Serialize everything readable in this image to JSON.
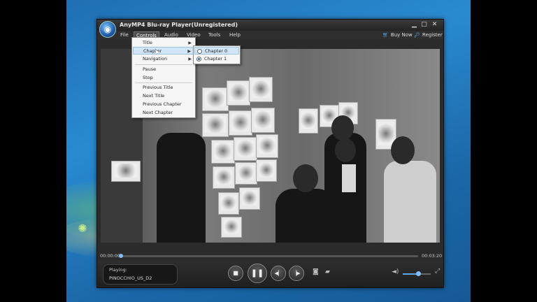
{
  "window": {
    "title": "AnyMP4 Blu-ray Player(Unregistered)",
    "minimize_icon": "minimize-icon",
    "maximize_icon": "maximize-icon",
    "close_icon": "close-icon"
  },
  "menubar": {
    "items": [
      "File",
      "Controls",
      "Audio",
      "Video",
      "Tools",
      "Help"
    ],
    "active": "Controls",
    "buy_now": "Buy Now",
    "register": "Register"
  },
  "controls_menu": {
    "items": [
      {
        "label": "Title",
        "has_submenu": true
      },
      {
        "label": "Chapter",
        "has_submenu": true,
        "highlighted": true
      },
      {
        "label": "Navigation",
        "has_submenu": true
      },
      {
        "label": "Pause"
      },
      {
        "label": "Stop"
      },
      {
        "label": "Previous Title"
      },
      {
        "label": "Next Title"
      },
      {
        "label": "Previous Chapter"
      },
      {
        "label": "Next Chapter"
      }
    ]
  },
  "chapter_submenu": {
    "items": [
      {
        "label": "Chapter 0",
        "selected": false,
        "highlighted": true
      },
      {
        "label": "Chapter 1",
        "selected": true
      }
    ]
  },
  "progress": {
    "current_time": "00:00:00",
    "total_time": "00:03:20",
    "played_fraction": 0.0
  },
  "now_playing": {
    "label": "Playing:",
    "file": "PINOCCHIO_US_D2"
  },
  "volume": {
    "level_fraction": 0.55
  },
  "colors": {
    "accent": "#5aa9e6",
    "window_bg": "#2b2b2b"
  }
}
